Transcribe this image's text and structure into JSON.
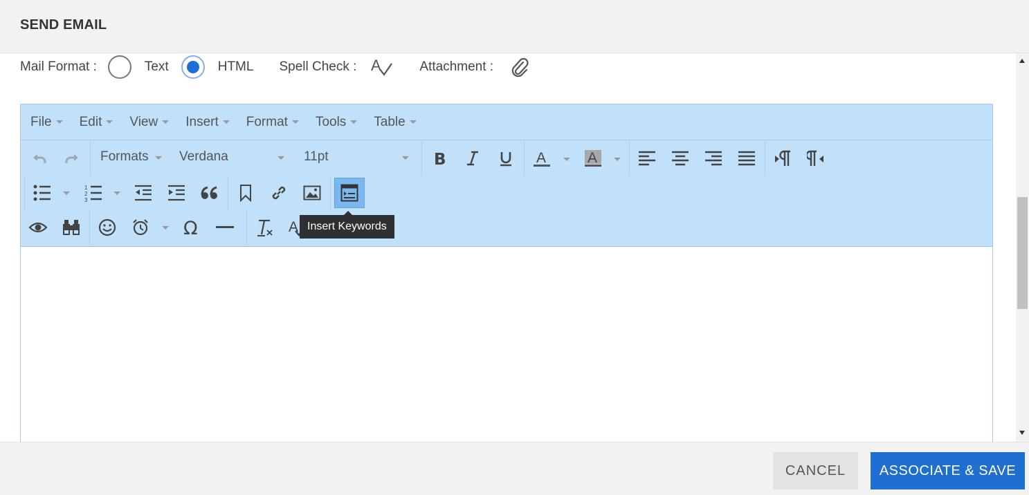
{
  "dialog": {
    "title": "SEND EMAIL"
  },
  "mail_format": {
    "label": "Mail Format :",
    "options": [
      {
        "label": "Text",
        "selected": false
      },
      {
        "label": "HTML",
        "selected": true
      }
    ],
    "spell_check_label": "Spell Check :",
    "attachment_label": "Attachment :"
  },
  "editor": {
    "menus": [
      "File",
      "Edit",
      "View",
      "Insert",
      "Format",
      "Tools",
      "Table"
    ],
    "formats_dropdown": "Formats",
    "font_family": "Verdana",
    "font_size": "11pt",
    "tooltip": "Insert Keywords",
    "accent_color": "#c1e0fa"
  },
  "footer": {
    "cancel_label": "CANCEL",
    "save_label": "ASSOCIATE & SAVE",
    "save_color": "#1f6fd1"
  }
}
